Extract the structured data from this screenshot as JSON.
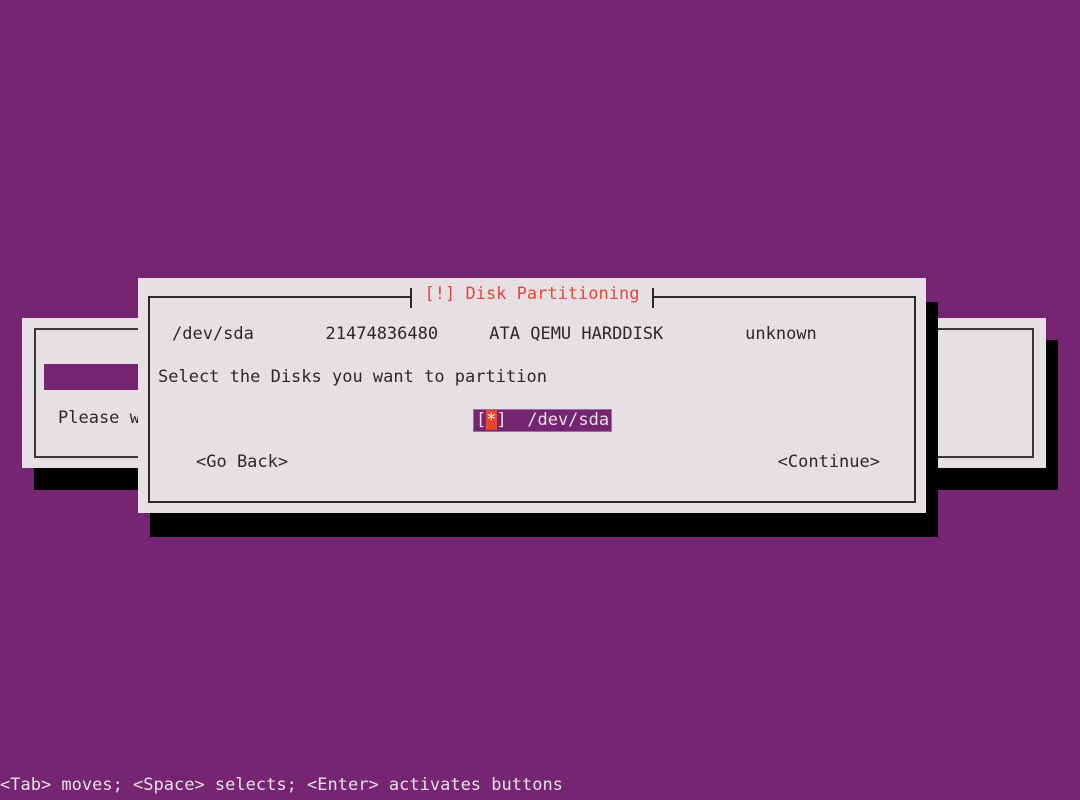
{
  "screen": {
    "background_color": "#762572",
    "dialog_bg_color": "#E6E0E4",
    "text_color": "#2A2A2A",
    "title_color": "#E8453C",
    "highlight_bg_color": "#762572",
    "cursor_bg_color": "#E8452C",
    "shadow_color": "#000000"
  },
  "background_dialog": {
    "name": "installer-progress-dialog",
    "progress_percent": 12,
    "wait_text": "Please wa"
  },
  "main_dialog": {
    "title": "[!] Disk Partitioning",
    "disk": {
      "device": "/dev/sda",
      "size_bytes": "21474836480",
      "model": "ATA QEMU HARDDISK",
      "label": "unknown",
      "row_text": "/dev/sda       21474836480     ATA QEMU HARDDISK        unknown"
    },
    "prompt": "Select the Disks you want to partition",
    "choices": [
      {
        "checkbox": "[*]",
        "mark": "*",
        "bracket_open": "[",
        "bracket_close": "]",
        "label": "/dev/sda",
        "selected": true
      }
    ],
    "buttons": {
      "go_back": "<Go Back>",
      "continue": "<Continue>"
    }
  },
  "statusbar": {
    "text": "<Tab> moves; <Space> selects; <Enter> activates buttons"
  }
}
